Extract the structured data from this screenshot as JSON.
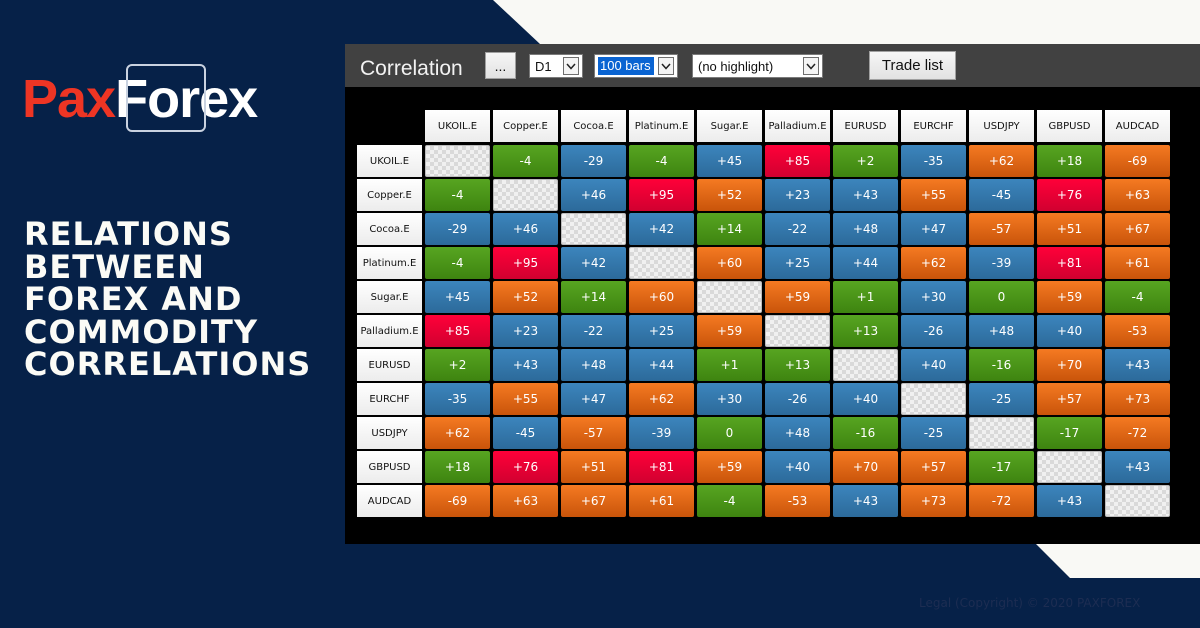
{
  "brand": {
    "logo_left": "Pax",
    "logo_right": "Forex",
    "colors": {
      "navy": "#062148",
      "logo_red": "#ee3524",
      "cream": "#f9f9f5"
    }
  },
  "headline": [
    "RELATIONS",
    "BETWEEN",
    "FOREX AND",
    "COMMODITY",
    "CORRELATIONS"
  ],
  "footer": {
    "copyright": "Legal (Copyright) ©  2020 PAXFOREX"
  },
  "toolbar": {
    "title": "Correlation",
    "more_button": "...",
    "timeframe": "D1",
    "bars": "100 bars",
    "highlight": "(no highlight)",
    "trade_list_button": "Trade list"
  },
  "matrix": {
    "symbols": [
      "UKOIL.E",
      "Copper.E",
      "Cocoa.E",
      "Platinum.E",
      "Sugar.E",
      "Palladium.E",
      "EURUSD",
      "EURCHF",
      "USDJPY",
      "GBPUSD",
      "AUDCAD"
    ],
    "colors": {
      "blue": "#3478ad",
      "green": "#4a9418",
      "orange": "#e86716",
      "red": "#ee0034"
    },
    "rows": [
      [
        null,
        "-4",
        "-29",
        "-4",
        "+45",
        "+85",
        "+2",
        "-35",
        "+62",
        "+18",
        "-69"
      ],
      [
        "-4",
        null,
        "+46",
        "+95",
        "+52",
        "+23",
        "+43",
        "+55",
        "-45",
        "+76",
        "+63"
      ],
      [
        "-29",
        "+46",
        null,
        "+42",
        "+14",
        "-22",
        "+48",
        "+47",
        "-57",
        "+51",
        "+67"
      ],
      [
        "-4",
        "+95",
        "+42",
        null,
        "+60",
        "+25",
        "+44",
        "+62",
        "-39",
        "+81",
        "+61"
      ],
      [
        "+45",
        "+52",
        "+14",
        "+60",
        null,
        "+59",
        "+1",
        "+30",
        "0",
        "+59",
        "-4"
      ],
      [
        "+85",
        "+23",
        "-22",
        "+25",
        "+59",
        null,
        "+13",
        "-26",
        "+48",
        "+40",
        "-53"
      ],
      [
        "+2",
        "+43",
        "+48",
        "+44",
        "+1",
        "+13",
        null,
        "+40",
        "-16",
        "+70",
        "+43"
      ],
      [
        "-35",
        "+55",
        "+47",
        "+62",
        "+30",
        "-26",
        "+40",
        null,
        "-25",
        "+57",
        "+73"
      ],
      [
        "+62",
        "-45",
        "-57",
        "-39",
        "0",
        "+48",
        "-16",
        "-25",
        null,
        "-17",
        "-72"
      ],
      [
        "+18",
        "+76",
        "+51",
        "+81",
        "+59",
        "+40",
        "+70",
        "+57",
        "-17",
        null,
        "+43"
      ],
      [
        "-69",
        "+63",
        "+67",
        "+61",
        "-4",
        "-53",
        "+43",
        "+73",
        "-72",
        "+43",
        null
      ]
    ],
    "cell_colors": [
      [
        "diag",
        "green",
        "blue",
        "green",
        "blue",
        "red",
        "green",
        "blue",
        "orange",
        "green",
        "orange"
      ],
      [
        "green",
        "diag",
        "blue",
        "red",
        "orange",
        "blue",
        "blue",
        "orange",
        "blue",
        "red",
        "orange"
      ],
      [
        "blue",
        "blue",
        "diag",
        "blue",
        "green",
        "blue",
        "blue",
        "blue",
        "orange",
        "orange",
        "orange"
      ],
      [
        "green",
        "red",
        "blue",
        "diag",
        "orange",
        "blue",
        "blue",
        "orange",
        "blue",
        "red",
        "orange"
      ],
      [
        "blue",
        "orange",
        "green",
        "orange",
        "diag",
        "orange",
        "green",
        "blue",
        "green",
        "orange",
        "green"
      ],
      [
        "red",
        "blue",
        "blue",
        "blue",
        "orange",
        "diag",
        "green",
        "blue",
        "blue",
        "blue",
        "orange"
      ],
      [
        "green",
        "blue",
        "blue",
        "blue",
        "green",
        "green",
        "diag",
        "blue",
        "green",
        "orange",
        "blue"
      ],
      [
        "blue",
        "orange",
        "blue",
        "orange",
        "blue",
        "blue",
        "blue",
        "diag",
        "blue",
        "orange",
        "orange"
      ],
      [
        "orange",
        "blue",
        "orange",
        "blue",
        "green",
        "blue",
        "green",
        "blue",
        "diag",
        "green",
        "orange"
      ],
      [
        "green",
        "red",
        "orange",
        "red",
        "orange",
        "blue",
        "orange",
        "orange",
        "green",
        "diag",
        "blue"
      ],
      [
        "orange",
        "orange",
        "orange",
        "orange",
        "green",
        "orange",
        "blue",
        "orange",
        "orange",
        "blue",
        "diag"
      ]
    ]
  }
}
